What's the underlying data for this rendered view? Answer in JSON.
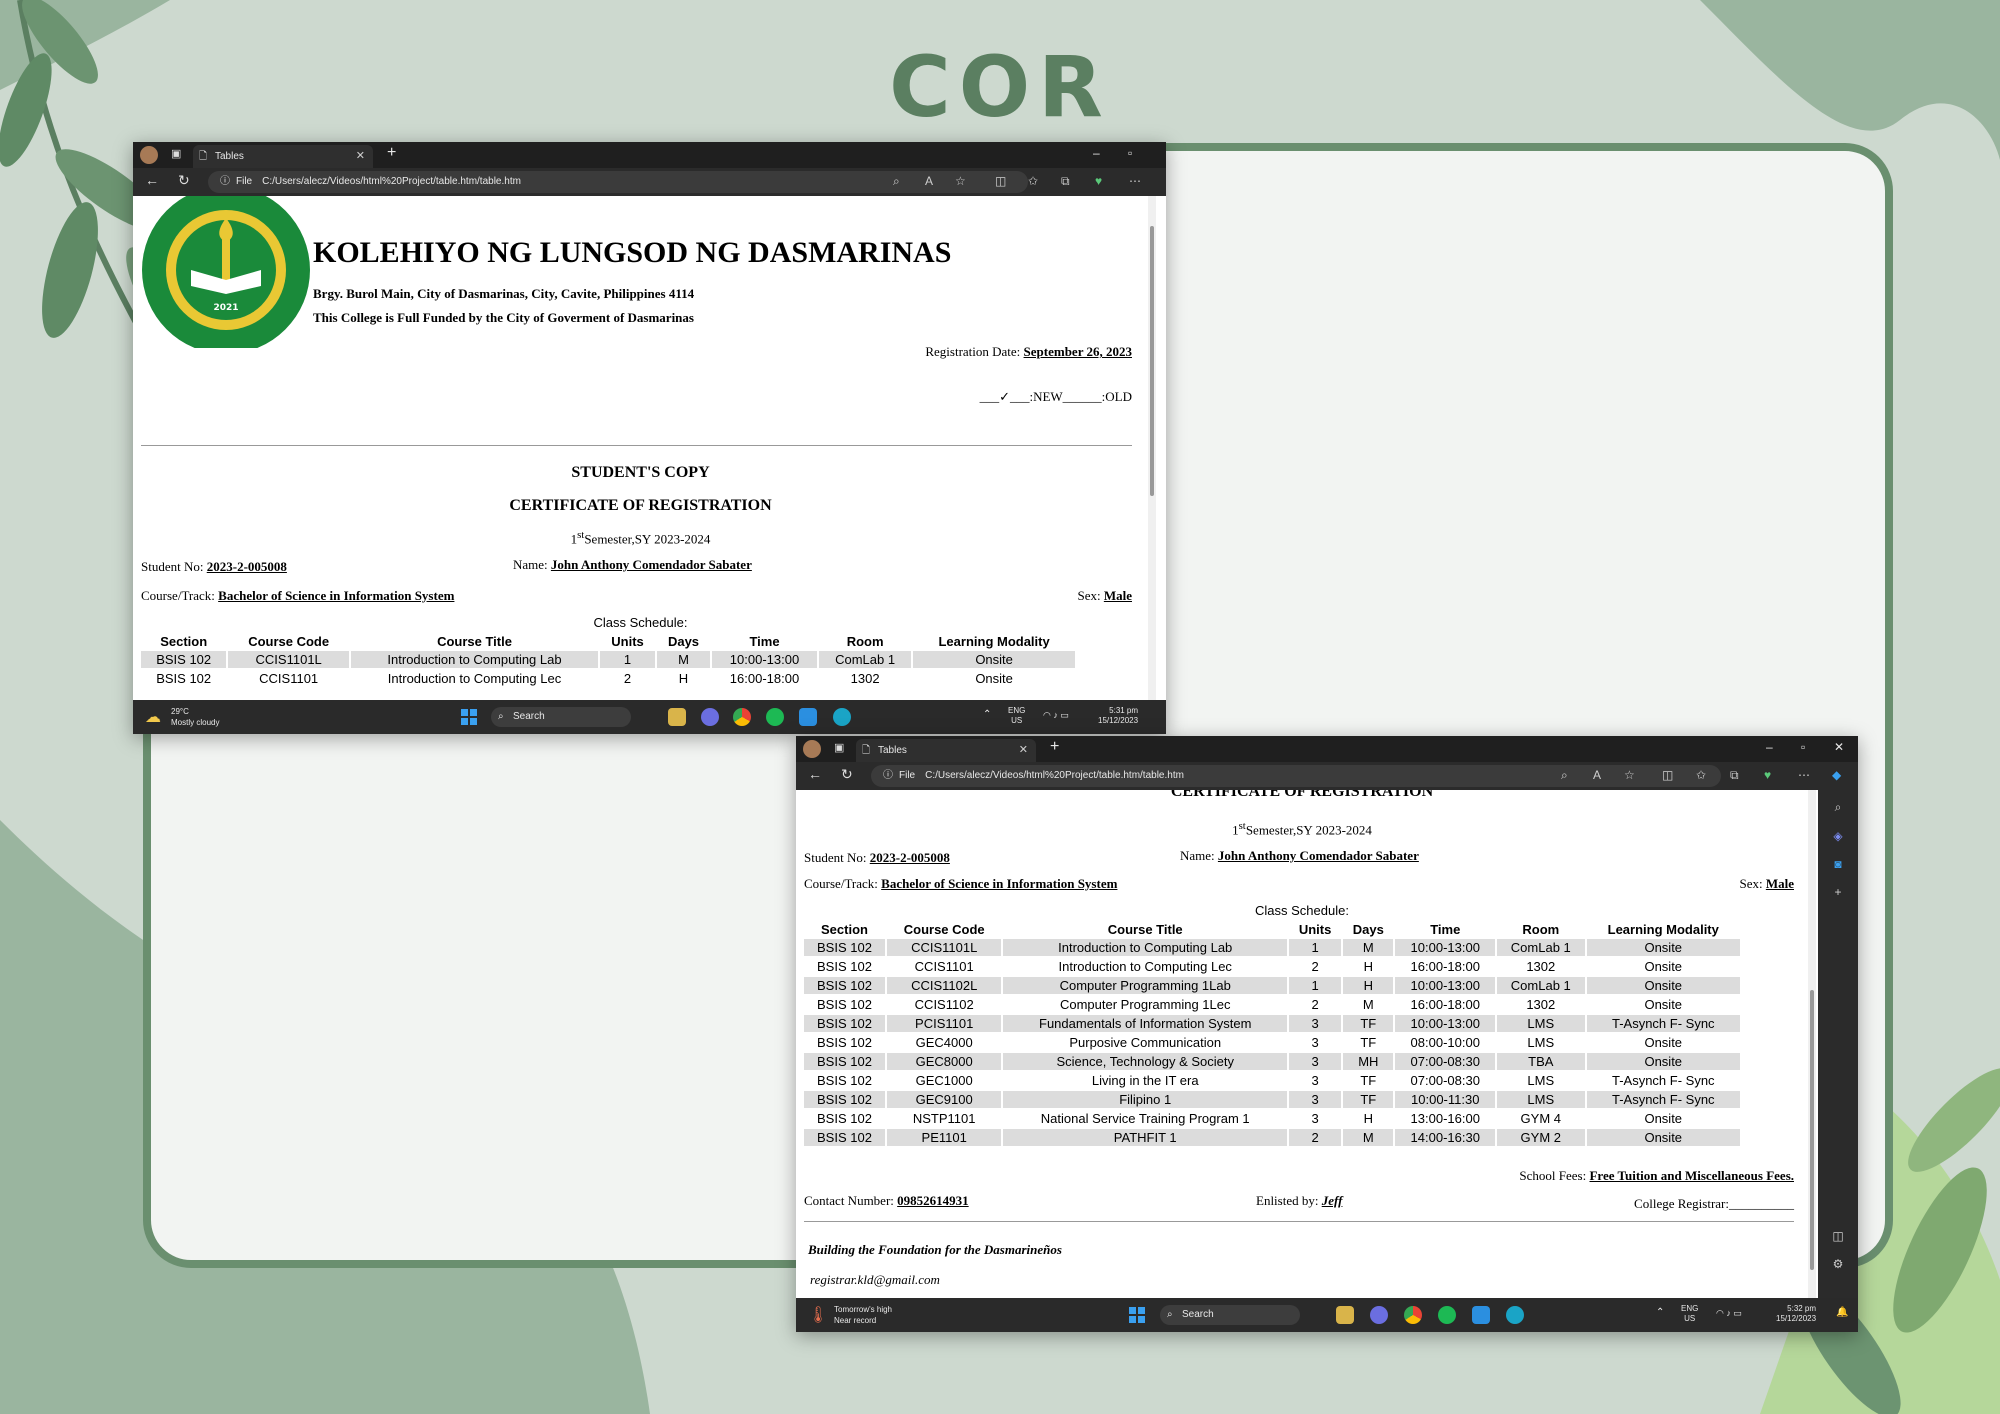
{
  "page_title": "COR",
  "colors": {
    "background": "#cdd9cf",
    "leaf": "#5b7f61",
    "panel": "#f2f4f2",
    "panel_border": "#6a8f6f"
  },
  "window1": {
    "tab_title": "Tables",
    "url_scheme": "File",
    "url": "C:/Users/alecz/Videos/html%20Project/table.htm/table.htm",
    "taskbar": {
      "weather_temp": "29°C",
      "weather_desc": "Mostly cloudy",
      "search": "Search",
      "lang": "ENG",
      "region": "US",
      "time": "5:31 pm",
      "date": "15/12/2023"
    }
  },
  "window2": {
    "tab_title": "Tables",
    "url_scheme": "File",
    "url": "C:/Users/alecz/Videos/html%20Project/table.htm/table.htm",
    "taskbar": {
      "weather_temp": "Tomorrow's high",
      "weather_desc": "Near record",
      "search": "Search",
      "lang": "ENG",
      "region": "US",
      "time": "5:32 pm",
      "date": "15/12/2023"
    }
  },
  "doc": {
    "college_name": "KOLEHIYO NG LUNGSOD NG DASMARINAS",
    "address": "Brgy. Burol Main, City of Dasmarinas, City, Cavite, Philippines 4114",
    "funding": "This College is Full Funded by the City of Goverment of Dasmarinas",
    "seal_top_text": "KOLEHIYO NG LUNGSOD NG DASMARINAS",
    "seal_bottom_text": "CITY OF DASMARIÑAS, CAVITE",
    "seal_year": "2021",
    "reg_date_label": "Registration Date:",
    "reg_date": "September 26, 2023",
    "new_old": "___✓___:NEW______:OLD",
    "copy_label": "STUDENT'S COPY",
    "cert_title": "CERTIFICATE OF REGISTRATION",
    "semester_num": "1",
    "semester_sup": "st",
    "semester_rest": "Semester,SY 2023-2024",
    "student_no_label": "Student No:",
    "student_no": "2023-2-005008",
    "name_label": "Name:",
    "name": "John Anthony Comendador Sabater",
    "course_label": "Course/Track:",
    "course": "Bachelor of Science in Information System",
    "sex_label": "Sex:",
    "sex": "Male",
    "schedule_label": "Class Schedule:",
    "headers": [
      "Section",
      "Course Code",
      "Course Title",
      "Units",
      "Days",
      "Time",
      "Room",
      "Learning Modality"
    ],
    "rows": [
      [
        "BSIS 102",
        "CCIS1101L",
        "Introduction to Computing Lab",
        "1",
        "M",
        "10:00-13:00",
        "ComLab 1",
        "Onsite"
      ],
      [
        "BSIS 102",
        "CCIS1101",
        "Introduction to Computing Lec",
        "2",
        "H",
        "16:00-18:00",
        "1302",
        "Onsite"
      ],
      [
        "BSIS 102",
        "CCIS1102L",
        "Computer Programming 1Lab",
        "1",
        "H",
        "10:00-13:00",
        "ComLab 1",
        "Onsite"
      ],
      [
        "BSIS 102",
        "CCIS1102",
        "Computer Programming 1Lec",
        "2",
        "M",
        "16:00-18:00",
        "1302",
        "Onsite"
      ],
      [
        "BSIS 102",
        "PCIS1101",
        "Fundamentals of Information System",
        "3",
        "TF",
        "10:00-13:00",
        "LMS",
        "T-Asynch F- Sync"
      ],
      [
        "BSIS 102",
        "GEC4000",
        "Purposive Communication",
        "3",
        "TF",
        "08:00-10:00",
        "LMS",
        "Onsite"
      ],
      [
        "BSIS 102",
        "GEC8000",
        "Science, Technology & Society",
        "3",
        "MH",
        "07:00-08:30",
        "TBA",
        "Onsite"
      ],
      [
        "BSIS 102",
        "GEC1000",
        "Living in the IT era",
        "3",
        "TF",
        "07:00-08:30",
        "LMS",
        "T-Asynch F- Sync"
      ],
      [
        "BSIS 102",
        "GEC9100",
        "Filipino 1",
        "3",
        "TF",
        "10:00-11:30",
        "LMS",
        "T-Asynch F- Sync"
      ],
      [
        "BSIS 102",
        "NSTP1101",
        "National Service Training Program 1",
        "3",
        "H",
        "13:00-16:00",
        "GYM 4",
        "Onsite"
      ],
      [
        "BSIS 102",
        "PE1101",
        "PATHFIT 1",
        "2",
        "M",
        "14:00-16:30",
        "GYM 2",
        "Onsite"
      ]
    ],
    "fees_label": "School Fees:",
    "fees": "Free Tuition and Miscellaneous Fees.",
    "contact_label": "Contact Number:",
    "contact": "09852614931",
    "enlisted_label": "Enlisted by:",
    "enlisted": "Jeff",
    "registrar_label": "College Registrar:__________",
    "motto": "Building the Foundation for the Dasmarineños",
    "email": "registrar.kld@gmail.com"
  }
}
